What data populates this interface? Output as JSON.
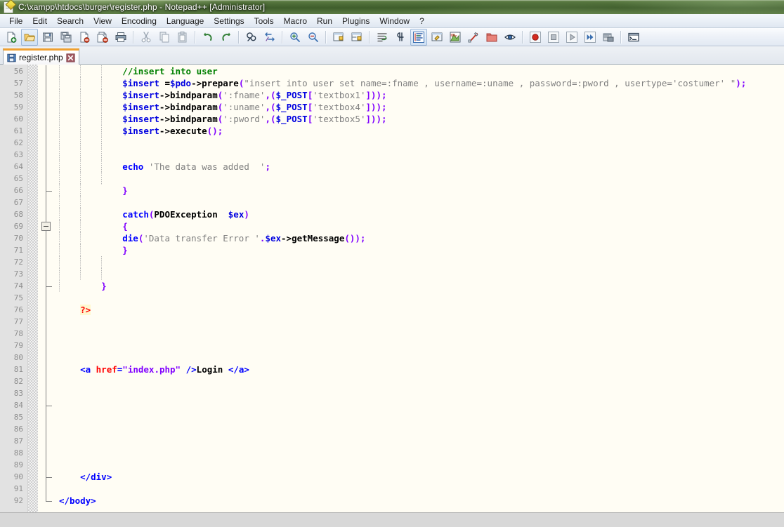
{
  "window": {
    "title": "C:\\xampp\\htdocs\\burger\\register.php - Notepad++ [Administrator]",
    "icon": "notepad-plus-plus-icon"
  },
  "menu": {
    "items": [
      {
        "label": "File"
      },
      {
        "label": "Edit"
      },
      {
        "label": "Search"
      },
      {
        "label": "View"
      },
      {
        "label": "Encoding"
      },
      {
        "label": "Language"
      },
      {
        "label": "Settings"
      },
      {
        "label": "Tools"
      },
      {
        "label": "Macro"
      },
      {
        "label": "Run"
      },
      {
        "label": "Plugins"
      },
      {
        "label": "Window"
      },
      {
        "label": "?"
      }
    ]
  },
  "toolbar": {
    "buttons": [
      {
        "name": "new-file-icon"
      },
      {
        "name": "open-file-icon"
      },
      {
        "name": "save-icon"
      },
      {
        "name": "save-all-icon"
      },
      {
        "name": "close-file-icon"
      },
      {
        "name": "close-all-files-icon"
      },
      {
        "name": "print-icon"
      },
      {
        "name": "separator"
      },
      {
        "name": "cut-icon"
      },
      {
        "name": "copy-icon"
      },
      {
        "name": "paste-icon"
      },
      {
        "name": "separator"
      },
      {
        "name": "undo-icon"
      },
      {
        "name": "redo-icon"
      },
      {
        "name": "separator"
      },
      {
        "name": "find-icon"
      },
      {
        "name": "replace-icon"
      },
      {
        "name": "separator"
      },
      {
        "name": "zoom-in-icon"
      },
      {
        "name": "zoom-out-icon"
      },
      {
        "name": "separator"
      },
      {
        "name": "sync-vertical-scroll-icon"
      },
      {
        "name": "sync-horizontal-scroll-icon"
      },
      {
        "name": "separator"
      },
      {
        "name": "word-wrap-icon"
      },
      {
        "name": "show-all-characters-icon"
      },
      {
        "name": "indent-guide-icon"
      },
      {
        "name": "user-defined-language-icon"
      },
      {
        "name": "document-map-icon"
      },
      {
        "name": "function-list-icon"
      },
      {
        "name": "folder-as-workspace-icon"
      },
      {
        "name": "monitoring-icon"
      },
      {
        "name": "separator"
      },
      {
        "name": "macro-record-icon"
      },
      {
        "name": "macro-stop-icon"
      },
      {
        "name": "macro-play-icon"
      },
      {
        "name": "macro-playback-multiple-icon"
      },
      {
        "name": "macro-save-icon"
      },
      {
        "name": "separator"
      },
      {
        "name": "run-icon"
      }
    ]
  },
  "tabs": [
    {
      "label": "register.php",
      "saved": true,
      "active": true
    }
  ],
  "editor": {
    "first_line": 56,
    "last_line": 92,
    "line_height": 17,
    "colors": {
      "background": "#fffdf4",
      "gutter": "#e2e2e2",
      "linenumber": "#8e8e8e",
      "comment": "#008000",
      "variable": "#0000e0",
      "keyword": "#0000ff",
      "string": "#808080",
      "punctuation": "#8000ff",
      "php_tag": "#ff0000",
      "html_tag": "#0000ff",
      "html_attribute": "#ff0000",
      "html_attr_value": "#8000ff"
    },
    "lines": [
      {
        "n": 56,
        "indent": 3,
        "guides": [
          1,
          2,
          3
        ],
        "tokens": [
          {
            "t": "//insert into user",
            "c": "t-com"
          }
        ]
      },
      {
        "n": 57,
        "indent": 3,
        "guides": [
          1,
          2,
          3
        ],
        "tokens": [
          {
            "t": "$insert ",
            "c": "t-var"
          },
          {
            "t": "=",
            "c": "t-op"
          },
          {
            "t": "$pdo",
            "c": "t-var"
          },
          {
            "t": "->",
            "c": "t-op"
          },
          {
            "t": "prepare",
            "c": "t-fn"
          },
          {
            "t": "(",
            "c": "t-pun"
          },
          {
            "t": "\"insert into user set name=:fname , username=:uname , password=:pword , usertype='costumer' \"",
            "c": "t-str"
          },
          {
            "t": ");",
            "c": "t-pun"
          }
        ]
      },
      {
        "n": 58,
        "indent": 3,
        "guides": [
          1,
          2,
          3
        ],
        "tokens": [
          {
            "t": "$insert",
            "c": "t-var"
          },
          {
            "t": "->",
            "c": "t-op"
          },
          {
            "t": "bindparam",
            "c": "t-fn"
          },
          {
            "t": "(",
            "c": "t-pun"
          },
          {
            "t": "':fname'",
            "c": "t-str"
          },
          {
            "t": ",(",
            "c": "t-pun"
          },
          {
            "t": "$_POST",
            "c": "t-var"
          },
          {
            "t": "[",
            "c": "t-pun"
          },
          {
            "t": "'textbox1'",
            "c": "t-str"
          },
          {
            "t": "]));",
            "c": "t-pun"
          }
        ]
      },
      {
        "n": 59,
        "indent": 3,
        "guides": [
          1,
          2,
          3
        ],
        "tokens": [
          {
            "t": "$insert",
            "c": "t-var"
          },
          {
            "t": "->",
            "c": "t-op"
          },
          {
            "t": "bindparam",
            "c": "t-fn"
          },
          {
            "t": "(",
            "c": "t-pun"
          },
          {
            "t": "':uname'",
            "c": "t-str"
          },
          {
            "t": ",(",
            "c": "t-pun"
          },
          {
            "t": "$_POST",
            "c": "t-var"
          },
          {
            "t": "[",
            "c": "t-pun"
          },
          {
            "t": "'textbox4'",
            "c": "t-str"
          },
          {
            "t": "]));",
            "c": "t-pun"
          }
        ]
      },
      {
        "n": 60,
        "indent": 3,
        "guides": [
          1,
          2,
          3
        ],
        "tokens": [
          {
            "t": "$insert",
            "c": "t-var"
          },
          {
            "t": "->",
            "c": "t-op"
          },
          {
            "t": "bindparam",
            "c": "t-fn"
          },
          {
            "t": "(",
            "c": "t-pun"
          },
          {
            "t": "':pword'",
            "c": "t-str"
          },
          {
            "t": ",(",
            "c": "t-pun"
          },
          {
            "t": "$_POST",
            "c": "t-var"
          },
          {
            "t": "[",
            "c": "t-pun"
          },
          {
            "t": "'textbox5'",
            "c": "t-str"
          },
          {
            "t": "]));",
            "c": "t-pun"
          }
        ]
      },
      {
        "n": 61,
        "indent": 3,
        "guides": [
          1,
          2,
          3
        ],
        "tokens": [
          {
            "t": "$insert",
            "c": "t-var"
          },
          {
            "t": "->",
            "c": "t-op"
          },
          {
            "t": "execute",
            "c": "t-fn"
          },
          {
            "t": "();",
            "c": "t-pun"
          }
        ]
      },
      {
        "n": 62,
        "indent": 3,
        "guides": [
          1,
          2,
          3
        ],
        "tokens": []
      },
      {
        "n": 63,
        "indent": 3,
        "guides": [
          1,
          2,
          3
        ],
        "tokens": []
      },
      {
        "n": 64,
        "indent": 3,
        "guides": [
          1,
          2,
          3
        ],
        "tokens": [
          {
            "t": "echo ",
            "c": "t-kw"
          },
          {
            "t": "'The data was added  '",
            "c": "t-str"
          },
          {
            "t": ";",
            "c": "t-pun"
          }
        ]
      },
      {
        "n": 65,
        "indent": 3,
        "guides": [
          1,
          2,
          3
        ],
        "tokens": []
      },
      {
        "n": 66,
        "indent": 3,
        "guides": [
          1,
          2
        ],
        "tokens": [
          {
            "t": "}",
            "c": "t-pun"
          }
        ]
      },
      {
        "n": 67,
        "indent": 3,
        "guides": [
          1,
          2
        ],
        "tokens": []
      },
      {
        "n": 68,
        "indent": 3,
        "guides": [
          1,
          2
        ],
        "tokens": [
          {
            "t": "catch",
            "c": "t-kw"
          },
          {
            "t": "(",
            "c": "t-pun"
          },
          {
            "t": "PDOException  ",
            "c": "t-fn"
          },
          {
            "t": "$ex",
            "c": "t-var"
          },
          {
            "t": ")",
            "c": "t-pun"
          }
        ]
      },
      {
        "n": 69,
        "indent": 3,
        "guides": [
          1,
          2
        ],
        "tokens": [
          {
            "t": "{",
            "c": "t-pun"
          }
        ]
      },
      {
        "n": 70,
        "indent": 3,
        "guides": [
          1,
          2
        ],
        "tokens": [
          {
            "t": "die",
            "c": "t-kw"
          },
          {
            "t": "(",
            "c": "t-pun"
          },
          {
            "t": "'Data transfer Error '",
            "c": "t-str"
          },
          {
            "t": ".",
            "c": "t-pun"
          },
          {
            "t": "$ex",
            "c": "t-var"
          },
          {
            "t": "->",
            "c": "t-op"
          },
          {
            "t": "getMessage",
            "c": "t-fn"
          },
          {
            "t": "());",
            "c": "t-pun"
          }
        ]
      },
      {
        "n": 71,
        "indent": 3,
        "guides": [
          1,
          2
        ],
        "tokens": [
          {
            "t": "}",
            "c": "t-pun"
          }
        ]
      },
      {
        "n": 72,
        "indent": 3,
        "guides": [
          1,
          2,
          3
        ],
        "tokens": []
      },
      {
        "n": 73,
        "indent": 3,
        "guides": [
          1,
          2,
          3
        ],
        "tokens": []
      },
      {
        "n": 74,
        "indent": 2,
        "guides": [
          1
        ],
        "tokens": [
          {
            "t": "}",
            "c": "t-pun"
          }
        ]
      },
      {
        "n": 75,
        "indent": 0,
        "guides": [],
        "tokens": []
      },
      {
        "n": 76,
        "indent": 1,
        "guides": [],
        "tokens": [
          {
            "t": "?>",
            "c": "t-php"
          }
        ]
      },
      {
        "n": 77,
        "indent": 0,
        "guides": [],
        "tokens": []
      },
      {
        "n": 78,
        "indent": 0,
        "guides": [],
        "tokens": []
      },
      {
        "n": 79,
        "indent": 0,
        "guides": [],
        "tokens": []
      },
      {
        "n": 80,
        "indent": 0,
        "guides": [],
        "tokens": []
      },
      {
        "n": 81,
        "indent": 1,
        "guides": [],
        "tokens": [
          {
            "t": "<a ",
            "c": "t-tag"
          },
          {
            "t": "href",
            "c": "t-attr"
          },
          {
            "t": "=",
            "c": "t-tag"
          },
          {
            "t": "\"index.php\"",
            "c": "t-aval"
          },
          {
            "t": " />",
            "c": "t-tag"
          },
          {
            "t": "Login ",
            "c": "t-txt"
          },
          {
            "t": "</a>",
            "c": "t-tag"
          }
        ]
      },
      {
        "n": 82,
        "indent": 0,
        "guides": [],
        "tokens": []
      },
      {
        "n": 83,
        "indent": 0,
        "guides": [],
        "tokens": []
      },
      {
        "n": 84,
        "indent": 0,
        "guides": [],
        "tokens": []
      },
      {
        "n": 85,
        "indent": 0,
        "guides": [],
        "tokens": []
      },
      {
        "n": 86,
        "indent": 0,
        "guides": [],
        "tokens": []
      },
      {
        "n": 87,
        "indent": 0,
        "guides": [],
        "tokens": []
      },
      {
        "n": 88,
        "indent": 0,
        "guides": [],
        "tokens": []
      },
      {
        "n": 89,
        "indent": 0,
        "guides": [],
        "tokens": []
      },
      {
        "n": 90,
        "indent": 1,
        "guides": [],
        "tokens": [
          {
            "t": "</div>",
            "c": "t-tag"
          }
        ]
      },
      {
        "n": 91,
        "indent": 0,
        "guides": [],
        "tokens": []
      },
      {
        "n": 92,
        "indent": 0,
        "guides": [],
        "tokens": [
          {
            "t": "</body>",
            "c": "t-tag"
          }
        ]
      }
    ],
    "fold_markers": [
      {
        "line": 66,
        "type": "tick"
      },
      {
        "line": 69,
        "type": "box-minus"
      },
      {
        "line": 74,
        "type": "tick"
      },
      {
        "line": 84,
        "type": "tick"
      },
      {
        "line": 90,
        "type": "tick"
      },
      {
        "line": 92,
        "type": "end"
      }
    ]
  }
}
